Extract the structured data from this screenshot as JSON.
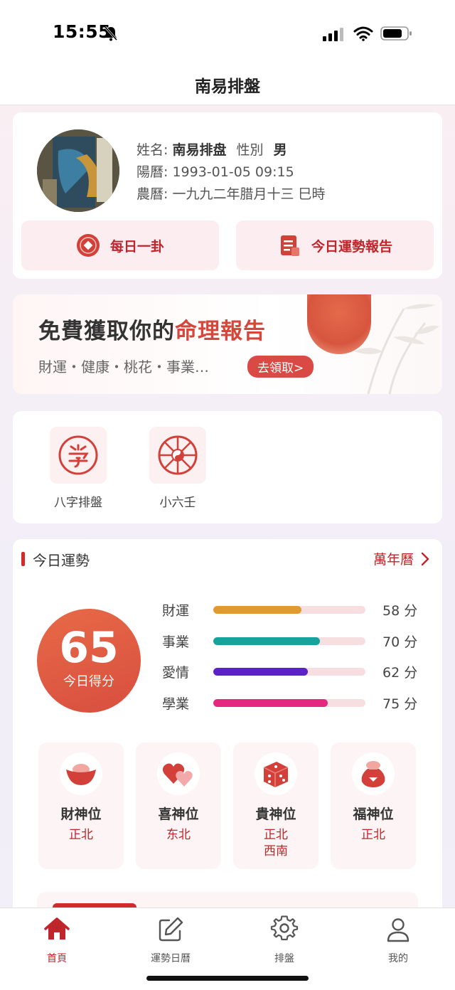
{
  "status_bar": {
    "time": "15:55"
  },
  "nav": {
    "title": "南易排盤"
  },
  "profile": {
    "name_label": "姓名:",
    "name": "南易排盘",
    "gender_label": "性別",
    "gender": "男",
    "solar_label": "陽曆:",
    "solar": "1993-01-05 09:15",
    "lunar_label": "農曆:",
    "lunar": "一九九二年腊月十三 巳時",
    "daily_button": "每日一卦",
    "report_button": "今日運勢報告"
  },
  "banner": {
    "title_main": "免費獲取你的",
    "title_accent": "命理報告",
    "subtitle": "財運・健康・桃花・事業…",
    "cta": "去領取>"
  },
  "tools": [
    {
      "label": "八字排盤",
      "icon": "bazi-seal-icon"
    },
    {
      "label": "小六壬",
      "icon": "taiji-wheel-icon"
    }
  ],
  "fortune": {
    "section_title": "今日運勢",
    "calendar_link": "萬年曆",
    "score": "65",
    "score_label": "今日得分",
    "metrics": [
      {
        "name": "財運",
        "value": 58,
        "score_text": "58 分",
        "color": "#e09a2e"
      },
      {
        "name": "事業",
        "value": 70,
        "score_text": "70 分",
        "color": "#16a39b"
      },
      {
        "name": "愛情",
        "value": 62,
        "score_text": "62 分",
        "color": "#5a22c8"
      },
      {
        "name": "學業",
        "value": 75,
        "score_text": "75 分",
        "color": "#e5287f"
      }
    ],
    "deities": [
      {
        "name": "財神位",
        "direction": "正北",
        "direction2": "",
        "icon": "gold-ingot-icon"
      },
      {
        "name": "喜神位",
        "direction": "东北",
        "direction2": "",
        "icon": "hearts-icon"
      },
      {
        "name": "貴神位",
        "direction": "正北",
        "direction2": "西南",
        "icon": "dice-icon"
      },
      {
        "name": "福神位",
        "direction": "正北",
        "direction2": "",
        "icon": "lucky-bag-icon"
      }
    ]
  },
  "tabs": [
    {
      "label": "首頁",
      "icon": "home-icon",
      "active": true
    },
    {
      "label": "運勢日曆",
      "icon": "edit-icon",
      "active": false
    },
    {
      "label": "排盤",
      "icon": "gear-icon",
      "active": false
    },
    {
      "label": "我的",
      "icon": "user-icon",
      "active": false
    }
  ],
  "colors": {
    "accent": "#c0252b",
    "score_gradient": "#e06345"
  }
}
